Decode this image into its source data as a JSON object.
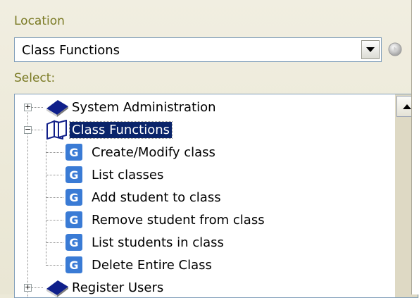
{
  "location": {
    "label": "Location",
    "selected_value": "Class Functions"
  },
  "select": {
    "label": "Select:"
  },
  "tree": {
    "nodes": [
      {
        "label": "System Administration",
        "icon": "book-icon",
        "expanded": false
      },
      {
        "label": "Class Functions",
        "icon": "open-book-icon",
        "expanded": true,
        "selected": true,
        "children": [
          {
            "label": "Create/Modify class",
            "icon": "cs-function-icon"
          },
          {
            "label": "List classes",
            "icon": "cs-function-icon"
          },
          {
            "label": "Add student to class",
            "icon": "cs-function-icon"
          },
          {
            "label": "Remove student from class",
            "icon": "cs-function-icon"
          },
          {
            "label": "List students in class",
            "icon": "cs-function-icon"
          },
          {
            "label": "Delete Entire Class",
            "icon": "cs-function-icon"
          }
        ]
      },
      {
        "label": "Register Users",
        "icon": "book-icon",
        "expanded": false
      }
    ]
  },
  "colors": {
    "selection": "#0a246a",
    "label_olive": "#7a7a24",
    "icon_blue": "#3a7bd5"
  }
}
